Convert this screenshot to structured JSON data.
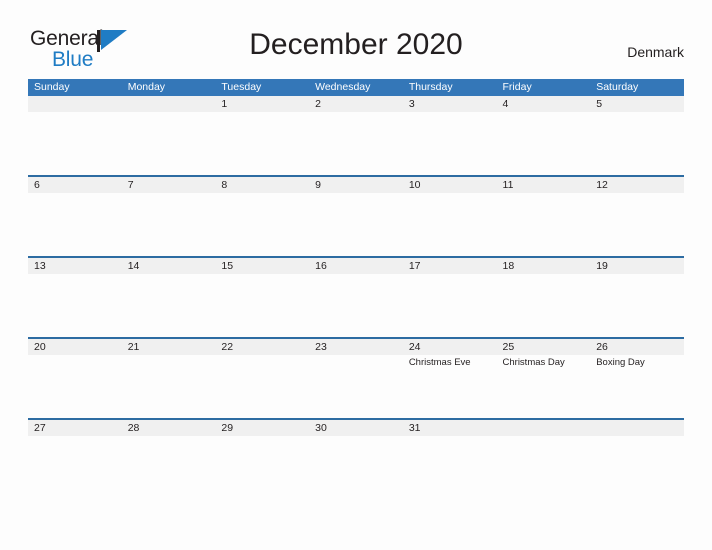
{
  "brand": {
    "word_one": "General",
    "word_two": "Blue",
    "flag_icon": "triangle-flag-icon",
    "accent_color": "#1f7cc4"
  },
  "header": {
    "title": "December 2020",
    "country": "Denmark"
  },
  "colors": {
    "header_blue": "#3477b8",
    "row_border_blue": "#2d6ca2",
    "date_band_gray": "#f0f0f0",
    "page_background": "#fdfdfd",
    "text": "#231f20"
  },
  "calendar": {
    "day_headers": [
      "Sunday",
      "Monday",
      "Tuesday",
      "Wednesday",
      "Thursday",
      "Friday",
      "Saturday"
    ],
    "weeks": [
      [
        {
          "date": "",
          "holiday": ""
        },
        {
          "date": "",
          "holiday": ""
        },
        {
          "date": "1",
          "holiday": ""
        },
        {
          "date": "2",
          "holiday": ""
        },
        {
          "date": "3",
          "holiday": ""
        },
        {
          "date": "4",
          "holiday": ""
        },
        {
          "date": "5",
          "holiday": ""
        }
      ],
      [
        {
          "date": "6",
          "holiday": ""
        },
        {
          "date": "7",
          "holiday": ""
        },
        {
          "date": "8",
          "holiday": ""
        },
        {
          "date": "9",
          "holiday": ""
        },
        {
          "date": "10",
          "holiday": ""
        },
        {
          "date": "11",
          "holiday": ""
        },
        {
          "date": "12",
          "holiday": ""
        }
      ],
      [
        {
          "date": "13",
          "holiday": ""
        },
        {
          "date": "14",
          "holiday": ""
        },
        {
          "date": "15",
          "holiday": ""
        },
        {
          "date": "16",
          "holiday": ""
        },
        {
          "date": "17",
          "holiday": ""
        },
        {
          "date": "18",
          "holiday": ""
        },
        {
          "date": "19",
          "holiday": ""
        }
      ],
      [
        {
          "date": "20",
          "holiday": ""
        },
        {
          "date": "21",
          "holiday": ""
        },
        {
          "date": "22",
          "holiday": ""
        },
        {
          "date": "23",
          "holiday": ""
        },
        {
          "date": "24",
          "holiday": "Christmas Eve"
        },
        {
          "date": "25",
          "holiday": "Christmas Day"
        },
        {
          "date": "26",
          "holiday": "Boxing Day"
        }
      ],
      [
        {
          "date": "27",
          "holiday": ""
        },
        {
          "date": "28",
          "holiday": ""
        },
        {
          "date": "29",
          "holiday": ""
        },
        {
          "date": "30",
          "holiday": ""
        },
        {
          "date": "31",
          "holiday": ""
        },
        {
          "date": "",
          "holiday": ""
        },
        {
          "date": "",
          "holiday": ""
        }
      ]
    ]
  }
}
